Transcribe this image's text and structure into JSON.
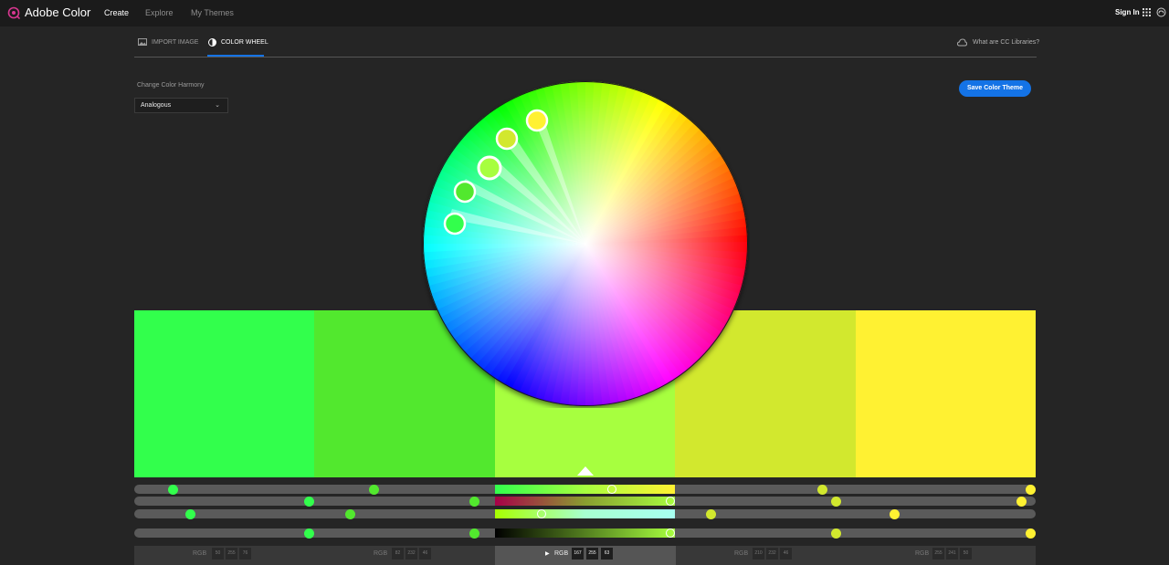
{
  "app": {
    "title": "Adobe Color",
    "brand_color": "#d83790"
  },
  "nav": {
    "create": "Create",
    "explore": "Explore",
    "my_themes": "My Themes",
    "sign_in": "Sign In"
  },
  "tabs": {
    "import_image": "IMPORT IMAGE",
    "color_wheel": "COLOR WHEEL",
    "cc_libraries": "What are CC Libraries?"
  },
  "harmony": {
    "label": "Change Color Harmony",
    "selected": "Analogous"
  },
  "save_button": "Save Color Theme",
  "swatches": [
    {
      "color": "#32ff4c"
    },
    {
      "color": "#52e82e"
    },
    {
      "color": "#a7ff3f"
    },
    {
      "color": "#d2e82e"
    },
    {
      "color": "#fff132"
    }
  ],
  "values": [
    {
      "mode": "RGB",
      "r": "50",
      "g": "255",
      "b": "76"
    },
    {
      "mode": "RGB",
      "r": "82",
      "g": "232",
      "b": "46"
    },
    {
      "mode": "RGB",
      "r": "167",
      "g": "255",
      "b": "63",
      "active": true
    },
    {
      "mode": "RGB",
      "r": "210",
      "g": "232",
      "b": "46"
    },
    {
      "mode": "RGB",
      "r": "255",
      "g": "241",
      "b": "50"
    }
  ]
}
